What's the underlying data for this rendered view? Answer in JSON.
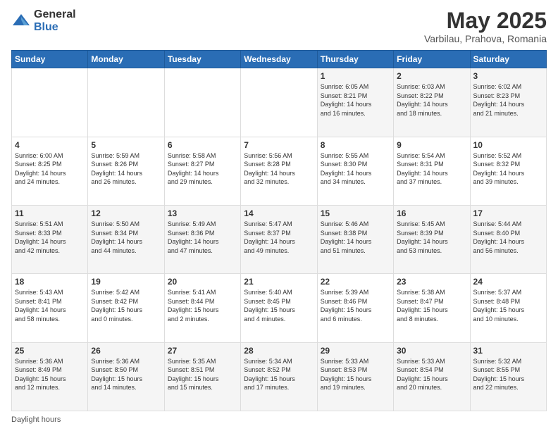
{
  "logo": {
    "general": "General",
    "blue": "Blue"
  },
  "header": {
    "month": "May 2025",
    "location": "Varbilau, Prahova, Romania"
  },
  "days_of_week": [
    "Sunday",
    "Monday",
    "Tuesday",
    "Wednesday",
    "Thursday",
    "Friday",
    "Saturday"
  ],
  "footer": {
    "label": "Daylight hours"
  },
  "weeks": [
    [
      {
        "day": "",
        "info": ""
      },
      {
        "day": "",
        "info": ""
      },
      {
        "day": "",
        "info": ""
      },
      {
        "day": "",
        "info": ""
      },
      {
        "day": "1",
        "info": "Sunrise: 6:05 AM\nSunset: 8:21 PM\nDaylight: 14 hours\nand 16 minutes."
      },
      {
        "day": "2",
        "info": "Sunrise: 6:03 AM\nSunset: 8:22 PM\nDaylight: 14 hours\nand 18 minutes."
      },
      {
        "day": "3",
        "info": "Sunrise: 6:02 AM\nSunset: 8:23 PM\nDaylight: 14 hours\nand 21 minutes."
      }
    ],
    [
      {
        "day": "4",
        "info": "Sunrise: 6:00 AM\nSunset: 8:25 PM\nDaylight: 14 hours\nand 24 minutes."
      },
      {
        "day": "5",
        "info": "Sunrise: 5:59 AM\nSunset: 8:26 PM\nDaylight: 14 hours\nand 26 minutes."
      },
      {
        "day": "6",
        "info": "Sunrise: 5:58 AM\nSunset: 8:27 PM\nDaylight: 14 hours\nand 29 minutes."
      },
      {
        "day": "7",
        "info": "Sunrise: 5:56 AM\nSunset: 8:28 PM\nDaylight: 14 hours\nand 32 minutes."
      },
      {
        "day": "8",
        "info": "Sunrise: 5:55 AM\nSunset: 8:30 PM\nDaylight: 14 hours\nand 34 minutes."
      },
      {
        "day": "9",
        "info": "Sunrise: 5:54 AM\nSunset: 8:31 PM\nDaylight: 14 hours\nand 37 minutes."
      },
      {
        "day": "10",
        "info": "Sunrise: 5:52 AM\nSunset: 8:32 PM\nDaylight: 14 hours\nand 39 minutes."
      }
    ],
    [
      {
        "day": "11",
        "info": "Sunrise: 5:51 AM\nSunset: 8:33 PM\nDaylight: 14 hours\nand 42 minutes."
      },
      {
        "day": "12",
        "info": "Sunrise: 5:50 AM\nSunset: 8:34 PM\nDaylight: 14 hours\nand 44 minutes."
      },
      {
        "day": "13",
        "info": "Sunrise: 5:49 AM\nSunset: 8:36 PM\nDaylight: 14 hours\nand 47 minutes."
      },
      {
        "day": "14",
        "info": "Sunrise: 5:47 AM\nSunset: 8:37 PM\nDaylight: 14 hours\nand 49 minutes."
      },
      {
        "day": "15",
        "info": "Sunrise: 5:46 AM\nSunset: 8:38 PM\nDaylight: 14 hours\nand 51 minutes."
      },
      {
        "day": "16",
        "info": "Sunrise: 5:45 AM\nSunset: 8:39 PM\nDaylight: 14 hours\nand 53 minutes."
      },
      {
        "day": "17",
        "info": "Sunrise: 5:44 AM\nSunset: 8:40 PM\nDaylight: 14 hours\nand 56 minutes."
      }
    ],
    [
      {
        "day": "18",
        "info": "Sunrise: 5:43 AM\nSunset: 8:41 PM\nDaylight: 14 hours\nand 58 minutes."
      },
      {
        "day": "19",
        "info": "Sunrise: 5:42 AM\nSunset: 8:42 PM\nDaylight: 15 hours\nand 0 minutes."
      },
      {
        "day": "20",
        "info": "Sunrise: 5:41 AM\nSunset: 8:44 PM\nDaylight: 15 hours\nand 2 minutes."
      },
      {
        "day": "21",
        "info": "Sunrise: 5:40 AM\nSunset: 8:45 PM\nDaylight: 15 hours\nand 4 minutes."
      },
      {
        "day": "22",
        "info": "Sunrise: 5:39 AM\nSunset: 8:46 PM\nDaylight: 15 hours\nand 6 minutes."
      },
      {
        "day": "23",
        "info": "Sunrise: 5:38 AM\nSunset: 8:47 PM\nDaylight: 15 hours\nand 8 minutes."
      },
      {
        "day": "24",
        "info": "Sunrise: 5:37 AM\nSunset: 8:48 PM\nDaylight: 15 hours\nand 10 minutes."
      }
    ],
    [
      {
        "day": "25",
        "info": "Sunrise: 5:36 AM\nSunset: 8:49 PM\nDaylight: 15 hours\nand 12 minutes."
      },
      {
        "day": "26",
        "info": "Sunrise: 5:36 AM\nSunset: 8:50 PM\nDaylight: 15 hours\nand 14 minutes."
      },
      {
        "day": "27",
        "info": "Sunrise: 5:35 AM\nSunset: 8:51 PM\nDaylight: 15 hours\nand 15 minutes."
      },
      {
        "day": "28",
        "info": "Sunrise: 5:34 AM\nSunset: 8:52 PM\nDaylight: 15 hours\nand 17 minutes."
      },
      {
        "day": "29",
        "info": "Sunrise: 5:33 AM\nSunset: 8:53 PM\nDaylight: 15 hours\nand 19 minutes."
      },
      {
        "day": "30",
        "info": "Sunrise: 5:33 AM\nSunset: 8:54 PM\nDaylight: 15 hours\nand 20 minutes."
      },
      {
        "day": "31",
        "info": "Sunrise: 5:32 AM\nSunset: 8:55 PM\nDaylight: 15 hours\nand 22 minutes."
      }
    ]
  ]
}
